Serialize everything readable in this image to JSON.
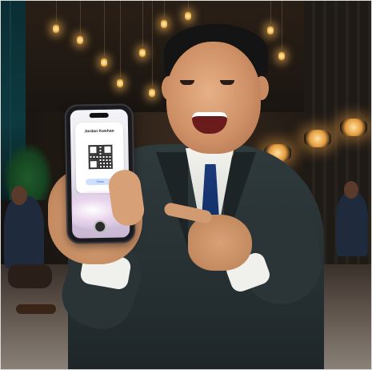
{
  "image": {
    "kind": "photo",
    "subject": "man smiling and pointing at phone showing a QR code"
  },
  "phone_screen": {
    "name": "Jordan Kwehan",
    "subtitle": "",
    "share_button": "Share"
  },
  "colors": {
    "suit": "#2f3a3c",
    "tie": "#1a3a7a",
    "warm_light": "#f2b34a",
    "teal_window": "#0d3a3f"
  },
  "icons": {
    "qr": "qr-code-icon",
    "home": "home-button-icon"
  }
}
